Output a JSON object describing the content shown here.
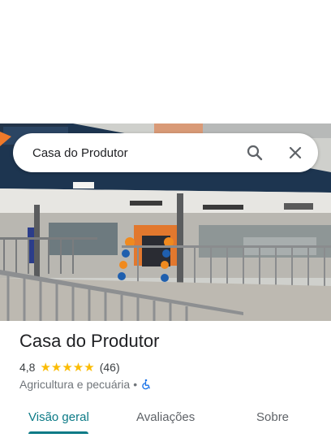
{
  "search": {
    "query": "Casa do Produtor"
  },
  "place": {
    "name": "Casa do Produtor",
    "rating": "4,8",
    "stars": "★★★★★",
    "review_count": "(46)",
    "category": "Agricultura e pecuária",
    "separator": "•"
  },
  "tabs": [
    {
      "label": "Visão geral",
      "active": true
    },
    {
      "label": "Avaliações",
      "active": false
    },
    {
      "label": "Sobre",
      "active": false
    }
  ],
  "colors": {
    "accent": "#0b7a86",
    "star": "#fbbc04"
  },
  "icons": [
    "search-icon",
    "close-icon",
    "wheelchair-accessible-icon"
  ]
}
